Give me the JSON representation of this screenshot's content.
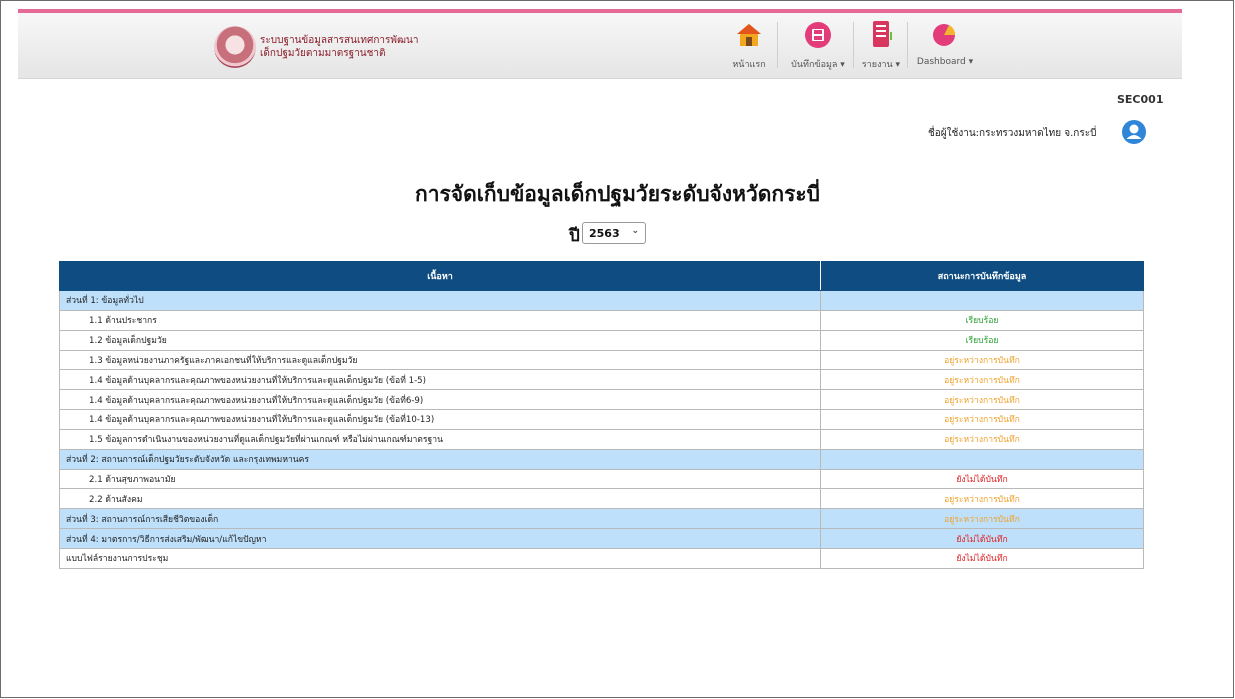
{
  "header": {
    "brand_line1": "ระบบฐานข้อมูลสารสนเทศการพัฒนา",
    "brand_line2": "เด็กปฐมวัยตามมาตรฐานชาติ",
    "nav": [
      {
        "label": "หน้าแรก",
        "icon": "home-icon"
      },
      {
        "label": "บันทึกข้อมูล ▾",
        "icon": "save-icon"
      },
      {
        "label": "รายงาน ▾",
        "icon": "report-icon"
      },
      {
        "label": "Dashboard ▾",
        "icon": "pie-chart-icon"
      }
    ],
    "colors": {
      "accent_bar": "#e46a97",
      "table_header": "#0f4c81",
      "section_row": "#bfe0fb"
    }
  },
  "user": {
    "code": "SEC001",
    "name": "ชื่อผู้ใช้งาน:กระทรวงมหาดไทย จ.กระบี่"
  },
  "page": {
    "title": "การจัดเก็บข้อมูลเด็กปฐมวัยระดับจังหวัดกระบี่",
    "year_label": "ปี",
    "year_value": "2563"
  },
  "table": {
    "headers": [
      "เนื้อหา",
      "สถานะการบันทึกข้อมูล"
    ],
    "rows": [
      {
        "label": "ส่วนที่ 1: ข้อมูลทั่วไป",
        "status": ""
      },
      {
        "label": "1.1 ด้านประชากร",
        "status": "เรียบร้อย"
      },
      {
        "label": "1.2 ข้อมูลเด็กปฐมวัย",
        "status": "เรียบร้อย"
      },
      {
        "label": "1.3 ข้อมูลหน่วยงานภาครัฐและภาคเอกชนที่ให้บริการและดูแลเด็กปฐมวัย",
        "status": "อยู่ระหว่างการบันทึก"
      },
      {
        "label": "1.4 ข้อมูลด้านบุคลากรและคุณภาพของหน่วยงานที่ให้บริการและดูแลเด็กปฐมวัย (ข้อที่ 1-5)",
        "status": "อยู่ระหว่างการบันทึก"
      },
      {
        "label": "1.4 ข้อมูลด้านบุคลากรและคุณภาพของหน่วยงานที่ให้บริการและดูแลเด็กปฐมวัย (ข้อที่6-9)",
        "status": "อยู่ระหว่างการบันทึก"
      },
      {
        "label": "1.4 ข้อมูลด้านบุคลากรและคุณภาพของหน่วยงานที่ให้บริการและดูแลเด็กปฐมวัย (ข้อที่10-13)",
        "status": "อยู่ระหว่างการบันทึก"
      },
      {
        "label": "1.5 ข้อมูลการดำเนินงานของหน่วยงานที่ดูแลเด็กปฐมวัยที่ผ่านเกณฑ์ หรือไม่ผ่านเกณฑ์มาตรฐาน",
        "status": "อยู่ระหว่างการบันทึก"
      },
      {
        "label": "ส่วนที่ 2: สถานการณ์เด็กปฐมวัยระดับจังหวัด และกรุงเทพมหานคร",
        "status": ""
      },
      {
        "label": "2.1 ด้านสุขภาพอนามัย",
        "status": "ยังไม่ได้บันทึก"
      },
      {
        "label": "2.2 ด้านสังคม",
        "status": "อยู่ระหว่างการบันทึก"
      },
      {
        "label": "ส่วนที่ 3: สถานการณ์การเสียชีวิตของเด็ก",
        "status": "อยู่ระหว่างการบันทึก"
      },
      {
        "label": "ส่วนที่ 4: มาตรการ/วิธีการส่งเสริม/พัฒนา/แก้ไขปัญหา",
        "status": "ยังไม่ได้บันทึก"
      },
      {
        "label": "แบบไฟล์รายงานการประชุม",
        "status": "ยังไม่ได้บันทึก"
      }
    ]
  }
}
